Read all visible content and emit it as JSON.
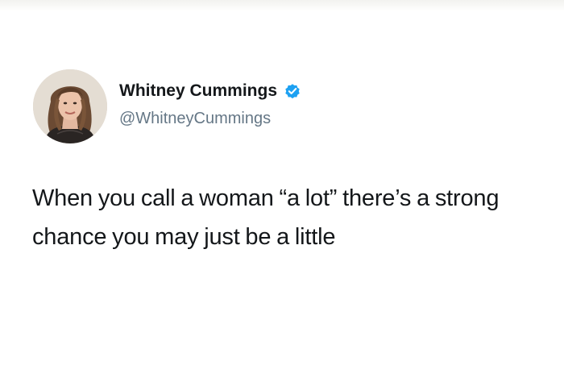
{
  "tweet": {
    "author": {
      "display_name": "Whitney Cummings",
      "handle": "@WhitneyCummings",
      "verified": true,
      "avatar_icon": "profile-photo"
    },
    "text": "When you call a woman “a lot” there’s a strong chance you may just be a little"
  },
  "colors": {
    "text": "#14171a",
    "handle": "#657786",
    "verified_badge": "#1da1f2",
    "background": "#ffffff"
  }
}
